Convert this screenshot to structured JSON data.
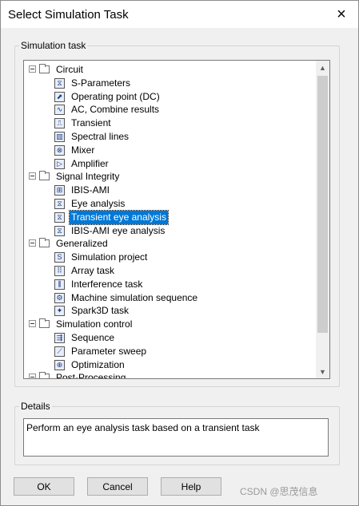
{
  "window": {
    "title": "Select Simulation Task",
    "close_icon": "×"
  },
  "task_group": {
    "label": "Simulation task"
  },
  "tree": {
    "categories": [
      {
        "label": "Circuit",
        "items": [
          {
            "label": "S-Parameters",
            "icon": "s-parameters-icon",
            "glyph": "⧖"
          },
          {
            "label": "Operating point (DC)",
            "icon": "operating-point-icon",
            "glyph": "⬈"
          },
          {
            "label": "AC, Combine results",
            "icon": "ac-icon",
            "glyph": "∿"
          },
          {
            "label": "Transient",
            "icon": "transient-icon",
            "glyph": "⎍"
          },
          {
            "label": "Spectral lines",
            "icon": "spectral-lines-icon",
            "glyph": "▥"
          },
          {
            "label": "Mixer",
            "icon": "mixer-icon",
            "glyph": "⊗"
          },
          {
            "label": "Amplifier",
            "icon": "amplifier-icon",
            "glyph": "▷"
          }
        ]
      },
      {
        "label": "Signal Integrity",
        "items": [
          {
            "label": "IBIS-AMI",
            "icon": "ibis-ami-icon",
            "glyph": "⊞"
          },
          {
            "label": "Eye analysis",
            "icon": "eye-analysis-icon",
            "glyph": "⧖"
          },
          {
            "label": "Transient eye analysis",
            "icon": "transient-eye-analysis-icon",
            "glyph": "⧖",
            "selected": true
          },
          {
            "label": "IBIS-AMI eye analysis",
            "icon": "ibis-ami-eye-analysis-icon",
            "glyph": "⧖"
          }
        ]
      },
      {
        "label": "Generalized",
        "items": [
          {
            "label": "Simulation project",
            "icon": "simulation-project-icon",
            "glyph": "S"
          },
          {
            "label": "Array task",
            "icon": "array-task-icon",
            "glyph": "⠿"
          },
          {
            "label": "Interference task",
            "icon": "interference-task-icon",
            "glyph": "⫼"
          },
          {
            "label": "Machine simulation sequence",
            "icon": "machine-simulation-icon",
            "glyph": "⚙"
          },
          {
            "label": "Spark3D task",
            "icon": "spark3d-icon",
            "glyph": "✦"
          }
        ]
      },
      {
        "label": "Simulation control",
        "items": [
          {
            "label": "Sequence",
            "icon": "sequence-icon",
            "glyph": "⇶"
          },
          {
            "label": "Parameter sweep",
            "icon": "parameter-sweep-icon",
            "glyph": "⟋"
          },
          {
            "label": "Optimization",
            "icon": "optimization-icon",
            "glyph": "⊕"
          }
        ]
      },
      {
        "label": "Post-Processing",
        "items": []
      }
    ]
  },
  "scrollbar": {
    "up_glyph": "▲",
    "down_glyph": "▼"
  },
  "details": {
    "label": "Details",
    "text": "Perform an eye analysis task based on a transient task"
  },
  "buttons": {
    "ok": "OK",
    "cancel": "Cancel",
    "help": "Help"
  },
  "watermark": "CSDN @思茂信息"
}
